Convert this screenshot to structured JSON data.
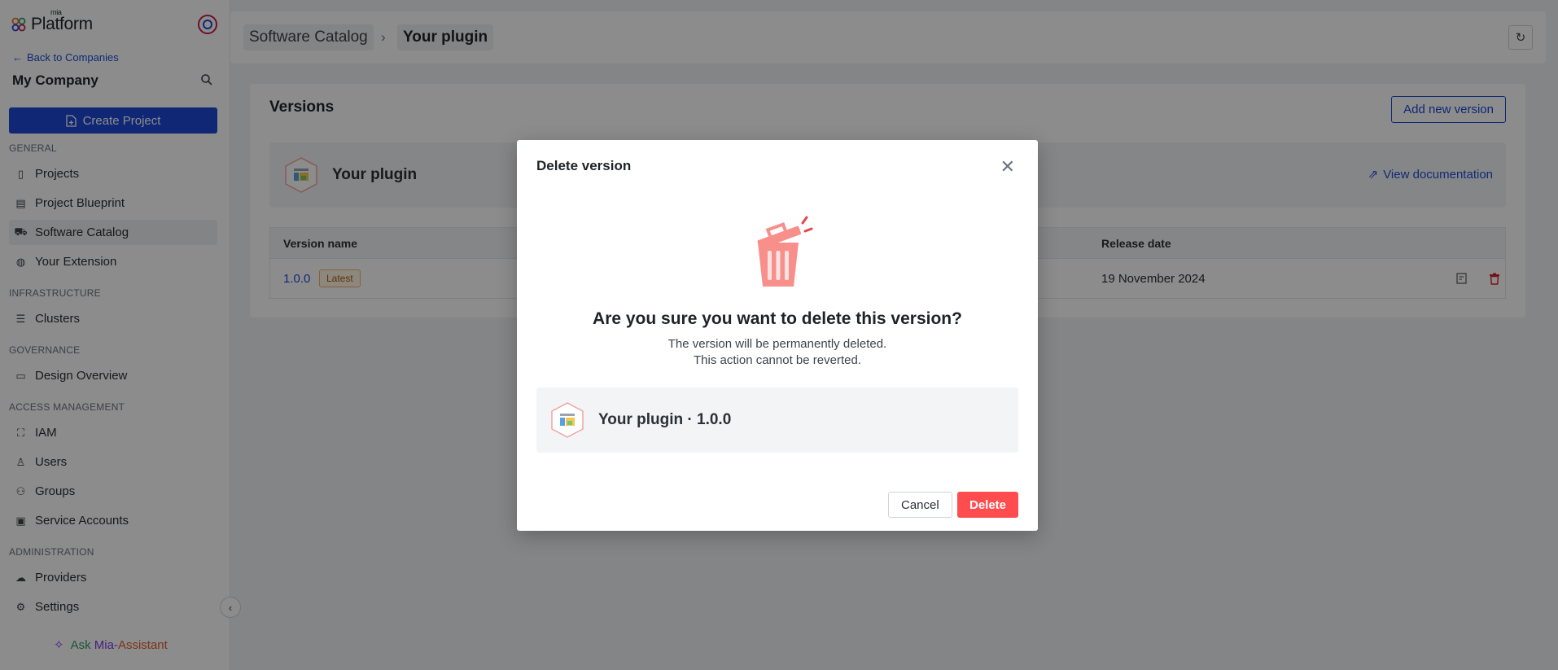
{
  "sidebar": {
    "logo_text": "Platform",
    "logo_small": "mia",
    "back_link": "Back to Companies",
    "company_name": "My Company",
    "create_project": "Create Project",
    "sections": {
      "general": "GENERAL",
      "infrastructure": "INFRASTRUCTURE",
      "governance": "GOVERNANCE",
      "access": "ACCESS MANAGEMENT",
      "administration": "ADMINISTRATION"
    },
    "items": {
      "projects": "Projects",
      "blueprint": "Project Blueprint",
      "catalog": "Software Catalog",
      "extension": "Your Extension",
      "clusters": "Clusters",
      "design": "Design Overview",
      "iam": "IAM",
      "users": "Users",
      "groups": "Groups",
      "service_accounts": "Service Accounts",
      "providers": "Providers",
      "settings": "Settings"
    },
    "assistant": {
      "ask": "Ask",
      "mia": "Mia-",
      "name": "Assistant"
    }
  },
  "header": {
    "crumb_root": "Software Catalog",
    "crumb_current": "Your plugin"
  },
  "versions": {
    "title": "Versions",
    "add_button": "Add new version",
    "plugin_name": "Your plugin",
    "view_doc": "View documentation",
    "columns": {
      "name": "Version name",
      "release": "Release date"
    },
    "rows": [
      {
        "version": "1.0.0",
        "tag": "Latest",
        "release": "19 November 2024"
      }
    ]
  },
  "modal": {
    "title": "Delete version",
    "heading": "Are you sure you want to delete this version?",
    "line1": "The version will be permanently deleted.",
    "line2": "This action cannot be reverted.",
    "plugin_label": "Your plugin · 1.0.0",
    "cancel": "Cancel",
    "delete": "Delete"
  },
  "colors": {
    "primary": "#1c47d6",
    "danger": "#ff4d4f",
    "overlay": "rgba(0,0,0,0.45)"
  }
}
